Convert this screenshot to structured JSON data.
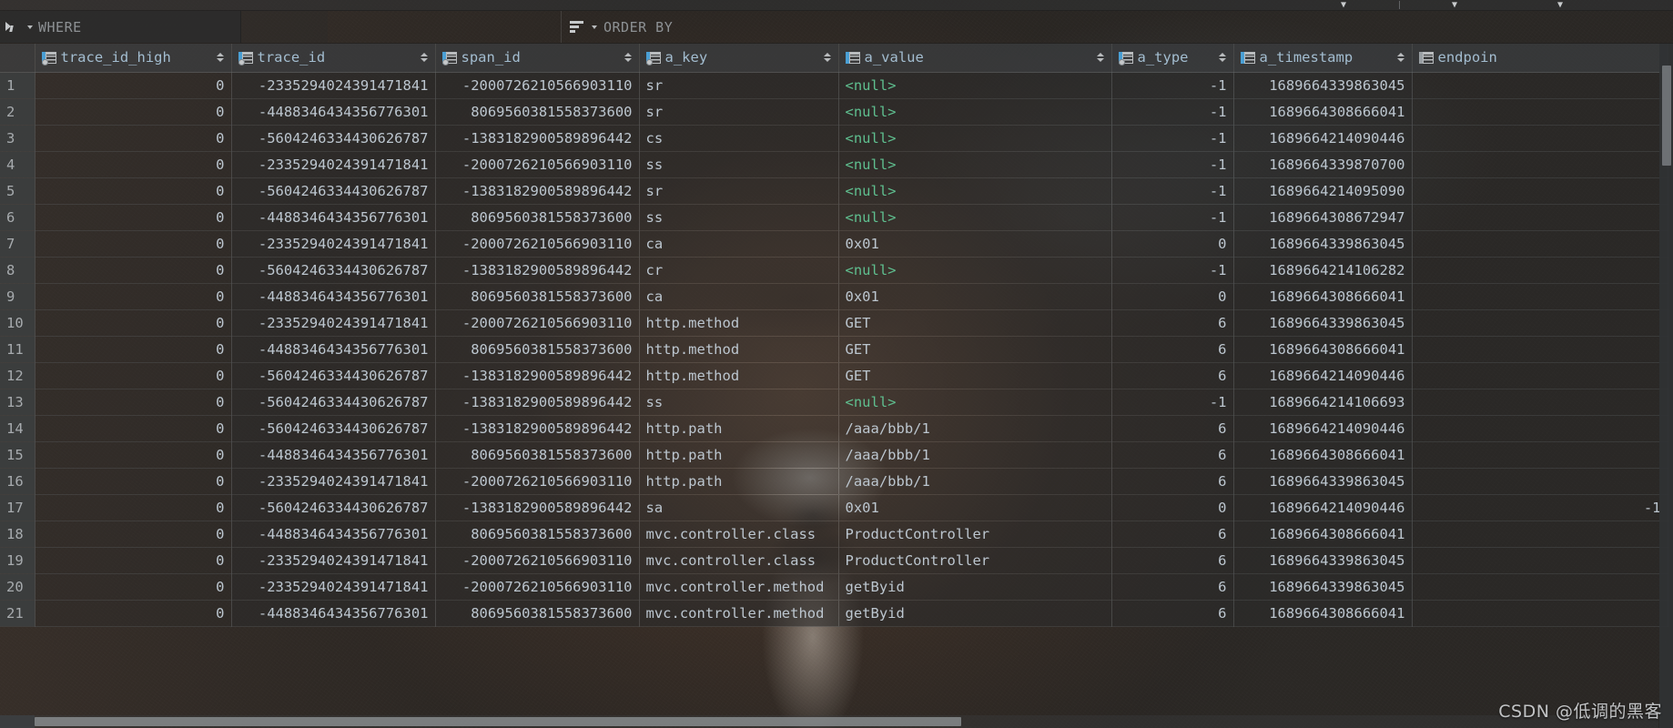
{
  "window": {
    "background_image": "lion-photo",
    "accent_color": "#4a9fd4",
    "null_color": "#5fbf8f",
    "text_color": "#bcc6cf",
    "header_text_color": "#a3bdd0"
  },
  "filterbar": {
    "filter_icon": "filter-funnel-icon",
    "where_label": "WHERE",
    "where_value": "",
    "where_placeholder": "",
    "sort_icon": "sort-lines-icon",
    "order_by_label": "ORDER BY",
    "order_by_value": "",
    "order_by_placeholder": ""
  },
  "top_strip": {
    "chevrons": [
      "chevron-down-icon",
      "chevron-down-icon",
      "chevron-down-icon"
    ]
  },
  "grid": {
    "columns": [
      {
        "name": "trace_id_high",
        "icon": "column-key-icon",
        "align": "num",
        "sortable": true
      },
      {
        "name": "trace_id",
        "icon": "column-key-icon",
        "align": "num",
        "sortable": true
      },
      {
        "name": "span_id",
        "icon": "column-key-icon",
        "align": "num",
        "sortable": true
      },
      {
        "name": "a_key",
        "icon": "column-key-icon",
        "align": "text",
        "sortable": true
      },
      {
        "name": "a_value",
        "icon": "column-icon",
        "align": "text",
        "sortable": true
      },
      {
        "name": "a_type",
        "icon": "column-key-icon",
        "align": "num",
        "sortable": true
      },
      {
        "name": "a_timestamp",
        "icon": "column-icon",
        "align": "num",
        "sortable": true
      },
      {
        "name": "endpoin",
        "icon": "column-icon-dim",
        "align": "num",
        "sortable": false
      }
    ],
    "rows": [
      {
        "n": "1",
        "trace_id_high": "0",
        "trace_id": "-2335294024391471841",
        "span_id": "-2000726210566903110",
        "a_key": "sr",
        "a_value": "<null>",
        "a_type": "-1",
        "a_timestamp": "1689664339863045",
        "endpoint": ""
      },
      {
        "n": "2",
        "trace_id_high": "0",
        "trace_id": "-4488346434356776301",
        "span_id": "8069560381558373600",
        "a_key": "sr",
        "a_value": "<null>",
        "a_type": "-1",
        "a_timestamp": "1689664308666041",
        "endpoint": ""
      },
      {
        "n": "3",
        "trace_id_high": "0",
        "trace_id": "-5604246334430626787",
        "span_id": "-1383182900589896442",
        "a_key": "cs",
        "a_value": "<null>",
        "a_type": "-1",
        "a_timestamp": "1689664214090446",
        "endpoint": ""
      },
      {
        "n": "4",
        "trace_id_high": "0",
        "trace_id": "-2335294024391471841",
        "span_id": "-2000726210566903110",
        "a_key": "ss",
        "a_value": "<null>",
        "a_type": "-1",
        "a_timestamp": "1689664339870700",
        "endpoint": ""
      },
      {
        "n": "5",
        "trace_id_high": "0",
        "trace_id": "-5604246334430626787",
        "span_id": "-1383182900589896442",
        "a_key": "sr",
        "a_value": "<null>",
        "a_type": "-1",
        "a_timestamp": "1689664214095090",
        "endpoint": ""
      },
      {
        "n": "6",
        "trace_id_high": "0",
        "trace_id": "-4488346434356776301",
        "span_id": "8069560381558373600",
        "a_key": "ss",
        "a_value": "<null>",
        "a_type": "-1",
        "a_timestamp": "1689664308672947",
        "endpoint": ""
      },
      {
        "n": "7",
        "trace_id_high": "0",
        "trace_id": "-2335294024391471841",
        "span_id": "-2000726210566903110",
        "a_key": "ca",
        "a_value": "0x01",
        "a_type": "0",
        "a_timestamp": "1689664339863045",
        "endpoint": ""
      },
      {
        "n": "8",
        "trace_id_high": "0",
        "trace_id": "-5604246334430626787",
        "span_id": "-1383182900589896442",
        "a_key": "cr",
        "a_value": "<null>",
        "a_type": "-1",
        "a_timestamp": "1689664214106282",
        "endpoint": ""
      },
      {
        "n": "9",
        "trace_id_high": "0",
        "trace_id": "-4488346434356776301",
        "span_id": "8069560381558373600",
        "a_key": "ca",
        "a_value": "0x01",
        "a_type": "0",
        "a_timestamp": "1689664308666041",
        "endpoint": ""
      },
      {
        "n": "10",
        "trace_id_high": "0",
        "trace_id": "-2335294024391471841",
        "span_id": "-2000726210566903110",
        "a_key": "http.method",
        "a_value": "GET",
        "a_type": "6",
        "a_timestamp": "1689664339863045",
        "endpoint": ""
      },
      {
        "n": "11",
        "trace_id_high": "0",
        "trace_id": "-4488346434356776301",
        "span_id": "8069560381558373600",
        "a_key": "http.method",
        "a_value": "GET",
        "a_type": "6",
        "a_timestamp": "1689664308666041",
        "endpoint": ""
      },
      {
        "n": "12",
        "trace_id_high": "0",
        "trace_id": "-5604246334430626787",
        "span_id": "-1383182900589896442",
        "a_key": "http.method",
        "a_value": "GET",
        "a_type": "6",
        "a_timestamp": "1689664214090446",
        "endpoint": ""
      },
      {
        "n": "13",
        "trace_id_high": "0",
        "trace_id": "-5604246334430626787",
        "span_id": "-1383182900589896442",
        "a_key": "ss",
        "a_value": "<null>",
        "a_type": "-1",
        "a_timestamp": "1689664214106693",
        "endpoint": ""
      },
      {
        "n": "14",
        "trace_id_high": "0",
        "trace_id": "-5604246334430626787",
        "span_id": "-1383182900589896442",
        "a_key": "http.path",
        "a_value": "/aaa/bbb/1",
        "a_type": "6",
        "a_timestamp": "1689664214090446",
        "endpoint": ""
      },
      {
        "n": "15",
        "trace_id_high": "0",
        "trace_id": "-4488346434356776301",
        "span_id": "8069560381558373600",
        "a_key": "http.path",
        "a_value": "/aaa/bbb/1",
        "a_type": "6",
        "a_timestamp": "1689664308666041",
        "endpoint": ""
      },
      {
        "n": "16",
        "trace_id_high": "0",
        "trace_id": "-2335294024391471841",
        "span_id": "-2000726210566903110",
        "a_key": "http.path",
        "a_value": "/aaa/bbb/1",
        "a_type": "6",
        "a_timestamp": "1689664339863045",
        "endpoint": ""
      },
      {
        "n": "17",
        "trace_id_high": "0",
        "trace_id": "-5604246334430626787",
        "span_id": "-1383182900589896442",
        "a_key": "sa",
        "a_value": "0x01",
        "a_type": "0",
        "a_timestamp": "1689664214090446",
        "endpoint": "-1"
      },
      {
        "n": "18",
        "trace_id_high": "0",
        "trace_id": "-4488346434356776301",
        "span_id": "8069560381558373600",
        "a_key": "mvc.controller.class",
        "a_value": "ProductController",
        "a_type": "6",
        "a_timestamp": "1689664308666041",
        "endpoint": ""
      },
      {
        "n": "19",
        "trace_id_high": "0",
        "trace_id": "-2335294024391471841",
        "span_id": "-2000726210566903110",
        "a_key": "mvc.controller.class",
        "a_value": "ProductController",
        "a_type": "6",
        "a_timestamp": "1689664339863045",
        "endpoint": ""
      },
      {
        "n": "20",
        "trace_id_high": "0",
        "trace_id": "-2335294024391471841",
        "span_id": "-2000726210566903110",
        "a_key": "mvc.controller.method",
        "a_value": "getByid",
        "a_type": "6",
        "a_timestamp": "1689664339863045",
        "endpoint": ""
      },
      {
        "n": "21",
        "trace_id_high": "0",
        "trace_id": "-4488346434356776301",
        "span_id": "8069560381558373600",
        "a_key": "mvc.controller.method",
        "a_value": "getByid",
        "a_type": "6",
        "a_timestamp": "1689664308666041",
        "endpoint": ""
      }
    ]
  },
  "watermark": {
    "text": "CSDN @低调的黑客"
  }
}
